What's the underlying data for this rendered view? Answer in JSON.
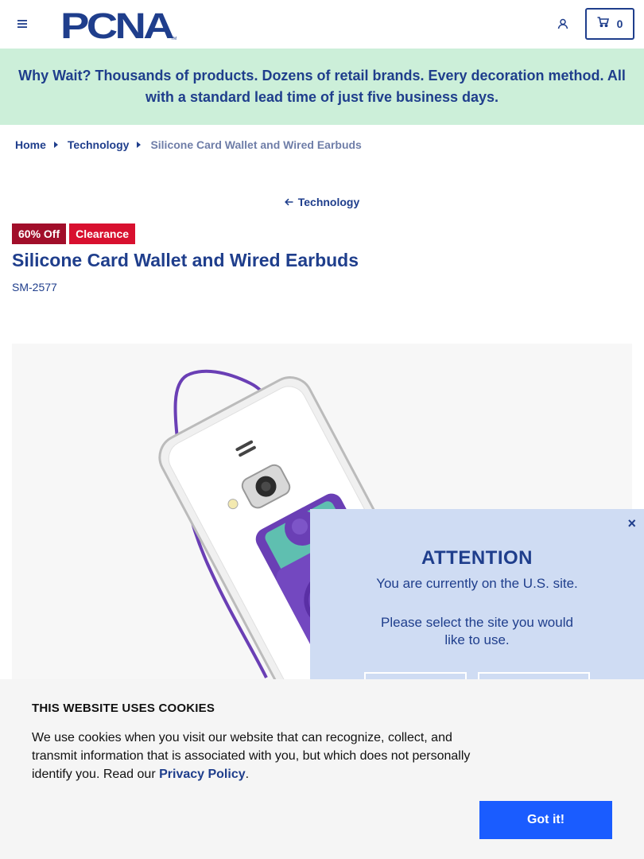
{
  "header": {
    "logo_text": "PCNA",
    "cart_count": "0"
  },
  "promo": {
    "text": "Why Wait? Thousands of products. Dozens of retail brands. Every decoration method. All with a standard lead time of just five business days."
  },
  "breadcrumb": {
    "items": [
      "Home",
      "Technology"
    ],
    "current": "Silicone Card Wallet and Wired Earbuds"
  },
  "back_link": {
    "label": "Technology"
  },
  "product": {
    "badges": [
      "60% Off",
      "Clearance"
    ],
    "title": "Silicone Card Wallet and Wired Earbuds",
    "sku": "SM-2577",
    "colors": {
      "accent": "#6a3fb5",
      "badge_discount": "#a10e2a",
      "badge_clearance": "#d8102f"
    }
  },
  "attention_modal": {
    "close": "×",
    "title": "ATTENTION",
    "message": "You are currently on the U.S. site.",
    "prompt": "Please select the site you would like to use."
  },
  "cookie_banner": {
    "title": "THIS WEBSITE USES COOKIES",
    "text": "We use cookies when you visit our website that can recognize, collect, and transmit information that is associated with you, but which does not personally identify you. Read our ",
    "link": "Privacy Policy",
    "end": ".",
    "button": "Got it!"
  },
  "colors": {
    "brand": "#1f3e8c",
    "promo_bg": "#ccefd9",
    "cookie_button": "#1a5cff",
    "modal_bg": "#cfdcf3"
  },
  "icons": {
    "menu": "hamburger-icon",
    "account": "user-icon",
    "cart": "cart-icon",
    "back": "arrow-left-icon",
    "breadcrumb_sep": "caret-right-icon"
  }
}
